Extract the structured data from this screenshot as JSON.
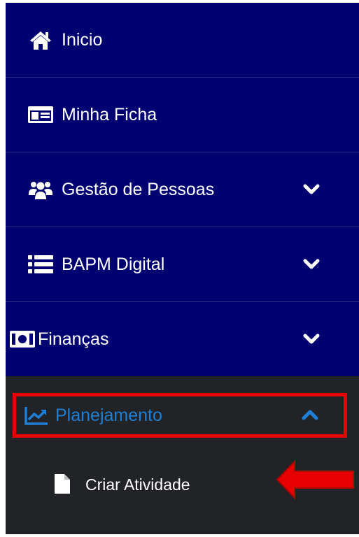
{
  "menu": {
    "items": [
      {
        "label": "Inicio",
        "icon": "home-icon",
        "expandable": false
      },
      {
        "label": "Minha Ficha",
        "icon": "id-card-icon",
        "expandable": false
      },
      {
        "label": "Gestão de Pessoas",
        "icon": "users-icon",
        "expandable": true
      },
      {
        "label": "BAPM Digital",
        "icon": "list-icon",
        "expandable": true
      },
      {
        "label": "Finanças",
        "icon": "money-icon",
        "expandable": true
      }
    ],
    "active": {
      "label": "Planejamento",
      "icon": "chart-line-icon",
      "expanded": true
    },
    "subitem": {
      "label": "Criar Atividade",
      "icon": "file-icon"
    }
  },
  "colors": {
    "menu_bg": "#000070",
    "submenu_bg": "#222326",
    "active_text": "#1f7fd6",
    "highlight": "#e60000"
  }
}
